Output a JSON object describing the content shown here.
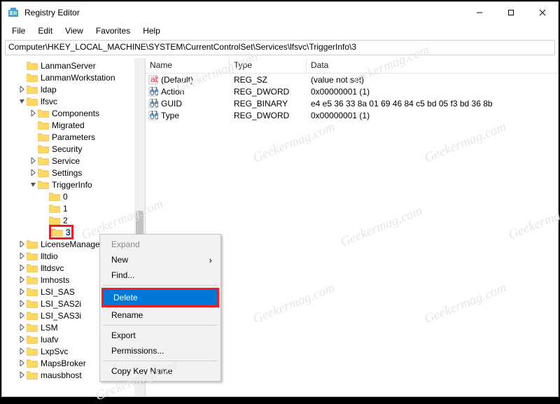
{
  "window": {
    "title": "Registry Editor"
  },
  "menu": {
    "file": "File",
    "edit": "Edit",
    "view": "View",
    "favorites": "Favorites",
    "help": "Help"
  },
  "address": "Computer\\HKEY_LOCAL_MACHINE\\SYSTEM\\CurrentControlSet\\Services\\lfsvc\\TriggerInfo\\3",
  "tree": [
    {
      "depth": 1,
      "toggle": "",
      "label": "LanmanServer"
    },
    {
      "depth": 1,
      "toggle": "",
      "label": "LanmanWorkstation"
    },
    {
      "depth": 1,
      "toggle": "closed",
      "label": "ldap"
    },
    {
      "depth": 1,
      "toggle": "open",
      "label": "lfsvc"
    },
    {
      "depth": 2,
      "toggle": "closed",
      "label": "Components"
    },
    {
      "depth": 2,
      "toggle": "",
      "label": "Migrated"
    },
    {
      "depth": 2,
      "toggle": "",
      "label": "Parameters"
    },
    {
      "depth": 2,
      "toggle": "",
      "label": "Security"
    },
    {
      "depth": 2,
      "toggle": "closed",
      "label": "Service"
    },
    {
      "depth": 2,
      "toggle": "closed",
      "label": "Settings"
    },
    {
      "depth": 2,
      "toggle": "open",
      "label": "TriggerInfo"
    },
    {
      "depth": 3,
      "toggle": "",
      "label": "0"
    },
    {
      "depth": 3,
      "toggle": "",
      "label": "1"
    },
    {
      "depth": 3,
      "toggle": "",
      "label": "2"
    },
    {
      "depth": 3,
      "toggle": "",
      "label": "3",
      "selected": true,
      "highlight": true
    },
    {
      "depth": 1,
      "toggle": "closed",
      "label": "LicenseManager"
    },
    {
      "depth": 1,
      "toggle": "closed",
      "label": "lltdio"
    },
    {
      "depth": 1,
      "toggle": "closed",
      "label": "lltdsvc"
    },
    {
      "depth": 1,
      "toggle": "closed",
      "label": "lmhosts"
    },
    {
      "depth": 1,
      "toggle": "closed",
      "label": "LSI_SAS"
    },
    {
      "depth": 1,
      "toggle": "closed",
      "label": "LSI_SAS2i"
    },
    {
      "depth": 1,
      "toggle": "closed",
      "label": "LSI_SAS3i"
    },
    {
      "depth": 1,
      "toggle": "closed",
      "label": "LSM"
    },
    {
      "depth": 1,
      "toggle": "closed",
      "label": "luafv"
    },
    {
      "depth": 1,
      "toggle": "closed",
      "label": "LxpSvc"
    },
    {
      "depth": 1,
      "toggle": "closed",
      "label": "MapsBroker"
    },
    {
      "depth": 1,
      "toggle": "closed",
      "label": "mausbhost"
    }
  ],
  "columns": {
    "name": "Name",
    "type": "Type",
    "data": "Data"
  },
  "values": [
    {
      "icon": "sz",
      "name": "(Default)",
      "type": "REG_SZ",
      "data": "(value not set)"
    },
    {
      "icon": "bin",
      "name": "Action",
      "type": "REG_DWORD",
      "data": "0x00000001 (1)"
    },
    {
      "icon": "bin",
      "name": "GUID",
      "type": "REG_BINARY",
      "data": "e4 e5 36 33 8a 01 69 46 84 c5 bd 05 f3 bd 36 8b"
    },
    {
      "icon": "bin",
      "name": "Type",
      "type": "REG_DWORD",
      "data": "0x00000001 (1)"
    }
  ],
  "ctx": {
    "expand": "Expand",
    "new": "New",
    "find": "Find...",
    "delete": "Delete",
    "rename": "Rename",
    "export": "Export",
    "permissions": "Permissions...",
    "copykey": "Copy Key Name"
  },
  "wm": "Geekermag.com"
}
